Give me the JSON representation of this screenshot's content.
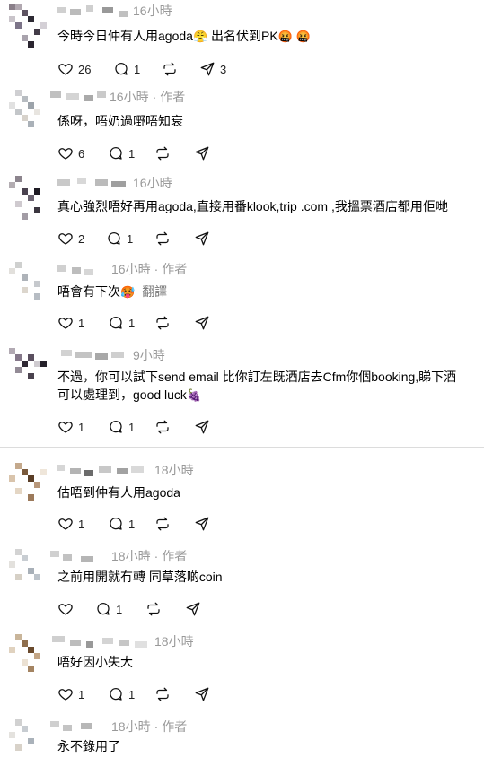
{
  "comments": [
    {
      "time": "16小時",
      "author_tag": "",
      "text": "今時今日仲有人用agoda",
      "text_tail": "出名伏到PK",
      "emoji1": "😤",
      "emoji2": "🤬",
      "emoji3": "🤬",
      "translate": "",
      "likes": "26",
      "replies": "1",
      "reposts": "",
      "shares": "3"
    },
    {
      "time": "16小時",
      "author_tag": "作者",
      "text": "係呀，唔奶過嘢唔知衰",
      "likes": "6",
      "replies": "1",
      "reposts": "",
      "shares": ""
    },
    {
      "time": "16小時",
      "author_tag": "",
      "text": "真心強烈唔好再用agoda,直接用番klook,trip .com ,我搵票酒店都用佢哋",
      "likes": "2",
      "replies": "1",
      "reposts": "",
      "shares": ""
    },
    {
      "time": "16小時",
      "author_tag": "作者",
      "text": "唔會有下次",
      "emoji1": "🥵",
      "translate": "翻譯",
      "likes": "1",
      "replies": "1",
      "reposts": "",
      "shares": ""
    },
    {
      "time": "9小時",
      "author_tag": "",
      "text": "不過，你可以試下send email 比你訂左既酒店去Cfm你個booking,睇下酒",
      "text2": "可以處理到，good luck",
      "emoji1": "🍇",
      "likes": "1",
      "replies": "1",
      "reposts": "",
      "shares": ""
    },
    {
      "time": "18小時",
      "author_tag": "",
      "text": "估唔到仲有人用agoda",
      "likes": "1",
      "replies": "1",
      "reposts": "",
      "shares": ""
    },
    {
      "time": "18小時",
      "author_tag": "作者",
      "text": "之前用開就冇轉 同草落啲coin",
      "likes": "",
      "replies": "1",
      "reposts": "",
      "shares": ""
    },
    {
      "time": "18小時",
      "author_tag": "",
      "text": "唔好因小失大",
      "likes": "1",
      "replies": "1",
      "reposts": "",
      "shares": ""
    },
    {
      "time": "18小時",
      "author_tag": "作者",
      "text": "永不錄用了"
    }
  ],
  "icons": {
    "like": "heart-icon",
    "reply": "comment-icon",
    "repost": "repost-icon",
    "share": "send-icon"
  },
  "colors": {
    "time": "#999999",
    "text": "#000000",
    "divider": "#dcdcdc"
  }
}
